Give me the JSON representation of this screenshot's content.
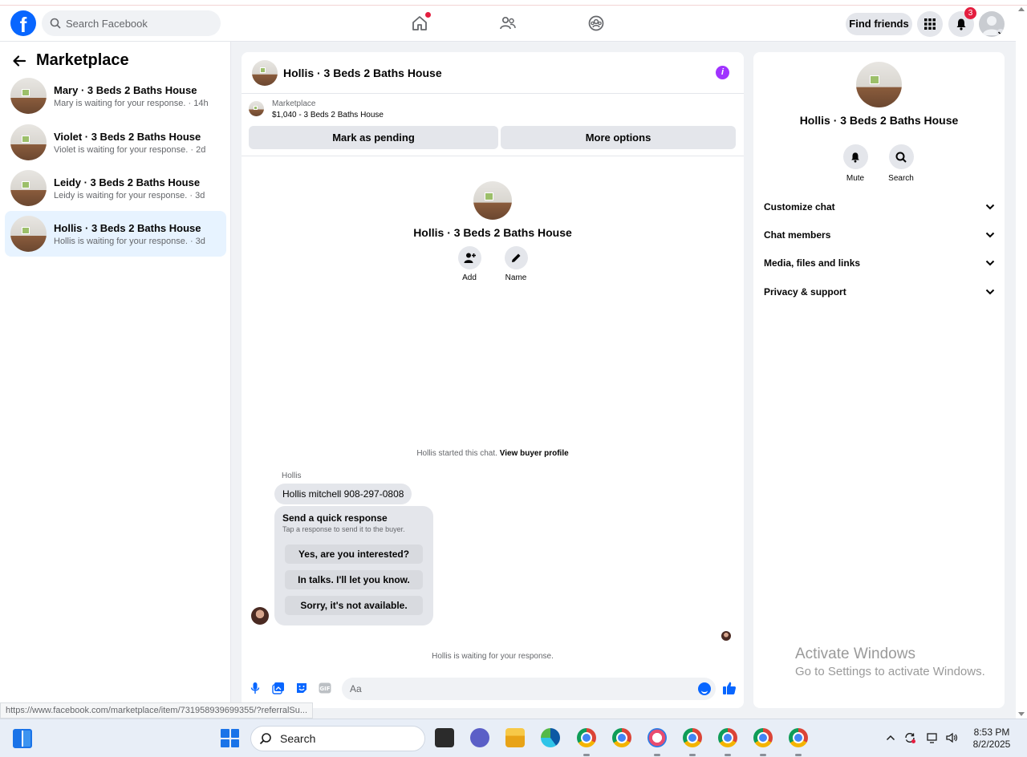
{
  "header": {
    "search_placeholder": "Search Facebook",
    "find_friends": "Find friends",
    "notification_count": "3"
  },
  "sidebar": {
    "title": "Marketplace",
    "conversations": [
      {
        "name": "Mary · 3 Beds 2 Baths House",
        "sub": "Mary is waiting for your response. · 14h"
      },
      {
        "name": "Violet · 3 Beds 2 Baths House",
        "sub": "Violet is waiting for your response. · 2d"
      },
      {
        "name": "Leidy · 3 Beds 2 Baths House",
        "sub": "Leidy is waiting for your response. · 3d"
      },
      {
        "name": "Hollis · 3 Beds 2 Baths House",
        "sub": "Hollis is waiting for your response. · 3d"
      }
    ]
  },
  "chat": {
    "title": "Hollis · 3 Beds 2 Baths House",
    "listing_label": "Marketplace",
    "listing_detail": "$1,040 - 3 Beds 2 Baths House",
    "mark_pending": "Mark as pending",
    "more_options": "More options",
    "profile_name": "Hollis · 3 Beds 2 Baths House",
    "add_label": "Add",
    "name_label": "Name",
    "started_text": "Hollis started this chat.",
    "view_profile": "View buyer profile",
    "sender": "Hollis",
    "message": "Hollis mitchell 908-297-0808",
    "quick_title": "Send a quick response",
    "quick_sub": "Tap a response to send it to the buyer.",
    "quick_responses": [
      "Yes, are you interested?",
      "In talks. I'll let you know.",
      "Sorry, it's not available."
    ],
    "waiting": "Hollis is waiting for your response.",
    "composer_placeholder": "Aa"
  },
  "right_panel": {
    "name": "Hollis · 3 Beds 2 Baths House",
    "mute": "Mute",
    "search": "Search",
    "sections": [
      "Customize chat",
      "Chat members",
      "Media, files and links",
      "Privacy & support"
    ],
    "watermark_title": "Activate Windows",
    "watermark_sub": "Go to Settings to activate Windows."
  },
  "status_url": "https://www.facebook.com/marketplace/item/731958939699355/?referralSu...",
  "taskbar": {
    "search": "Search",
    "time": "8:53 PM",
    "date": "8/2/2025"
  },
  "colors": {
    "brand": "#0866ff",
    "active_row": "#e7f3ff",
    "badge": "#e41e3f",
    "info": "#a033ff"
  }
}
